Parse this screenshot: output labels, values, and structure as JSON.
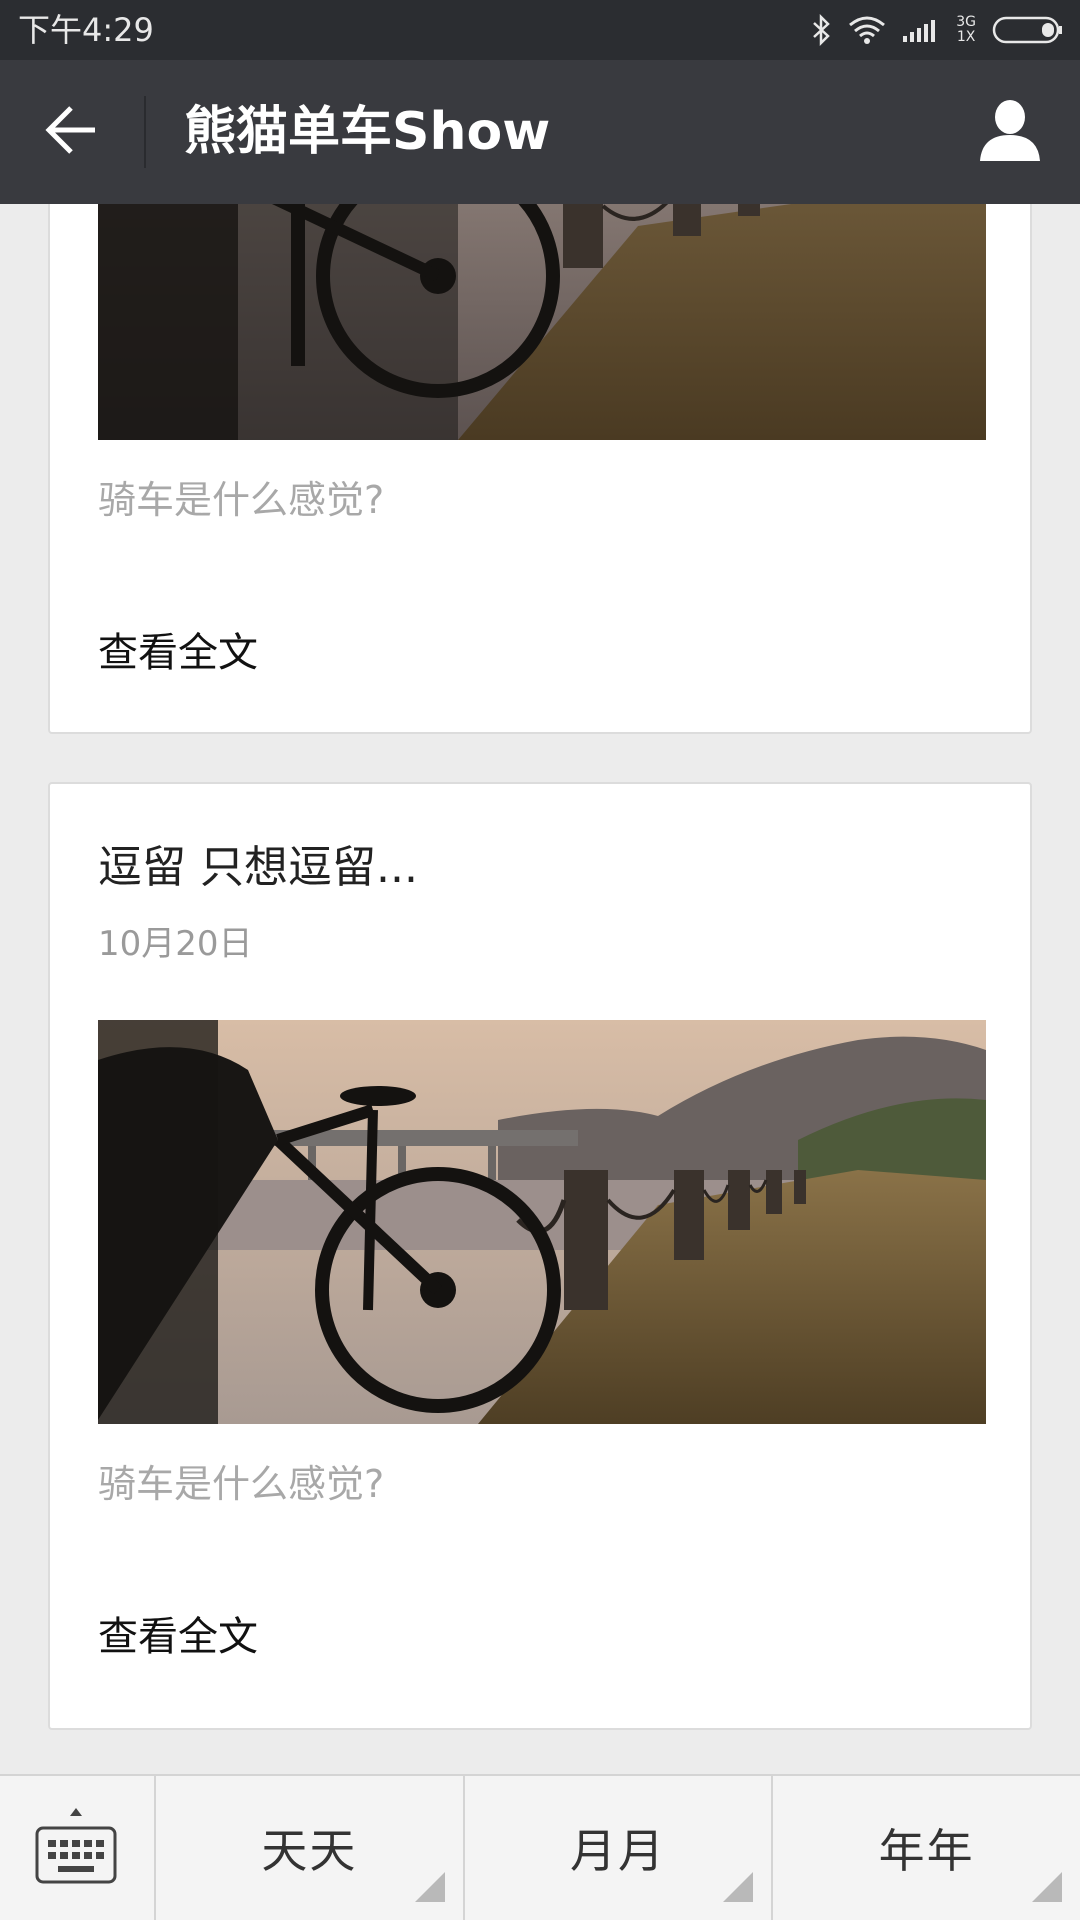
{
  "status_bar": {
    "time": "下午4:29",
    "network_top": "3G",
    "network_bottom": "1X",
    "icons": [
      "bluetooth-icon",
      "wifi-icon",
      "signal-icon",
      "battery-icon"
    ]
  },
  "header": {
    "title": "熊猫单车Show",
    "back_icon": "arrow-left-icon",
    "profile_icon": "person-icon"
  },
  "articles": [
    {
      "title": "",
      "date": "",
      "digest": "骑车是什么感觉?",
      "read_more": "查看全文"
    },
    {
      "title": "逗留 只想逗留...",
      "date": "10月20日",
      "digest": "骑车是什么感觉?",
      "read_more": "查看全文"
    }
  ],
  "bottom_menu": {
    "keyboard_icon": "keyboard-icon",
    "items": [
      {
        "label": "天天"
      },
      {
        "label": "月月"
      },
      {
        "label": "年年"
      }
    ]
  },
  "colors": {
    "status_bar": "#2b2d31",
    "title_bar": "#393a3f",
    "background": "#ececec",
    "card": "#ffffff",
    "digest_text": "#a8a8a8"
  }
}
